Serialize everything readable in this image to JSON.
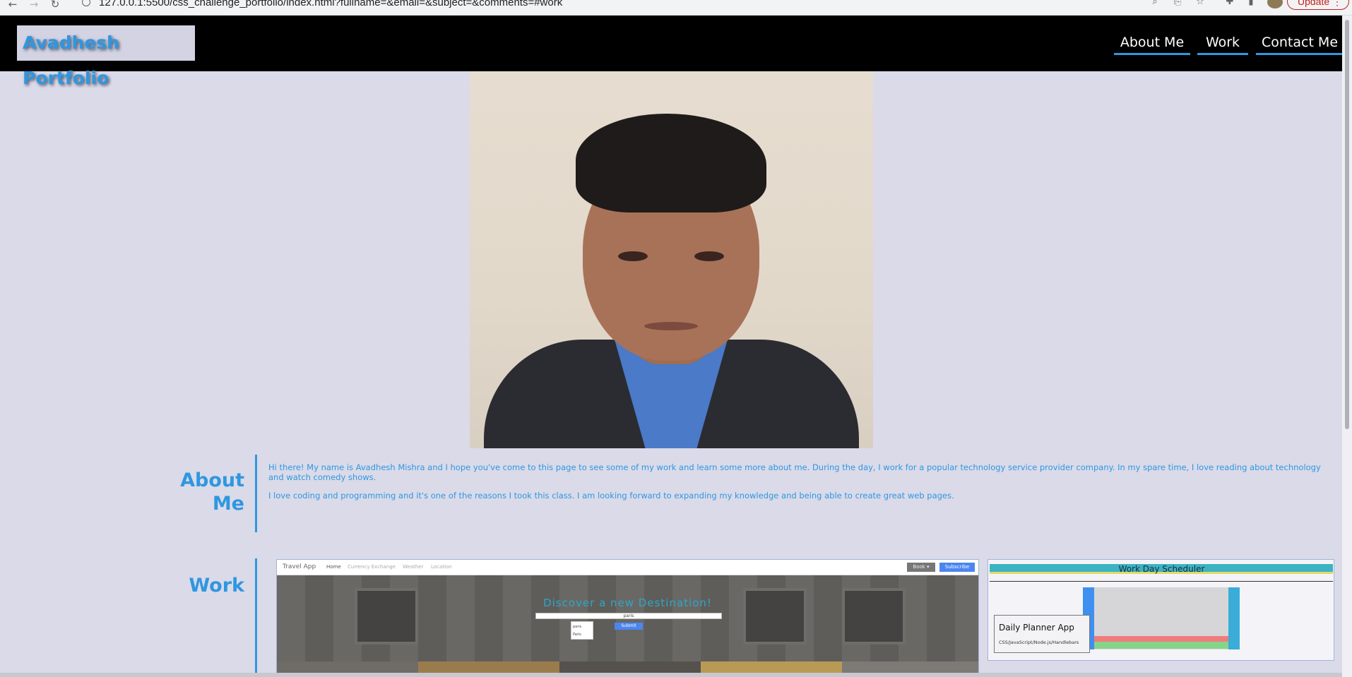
{
  "browser": {
    "url": "127.0.0.1:5500/css_challenge_portfolio/index.html?fullname=&email=&subject=&comments=#work",
    "update_label": "Update",
    "icons": [
      "back-icon",
      "forward-icon",
      "reload-icon",
      "info-icon",
      "zoom-icon",
      "share-icon",
      "star-icon",
      "extensions-icon",
      "sidebar-icon",
      "profile-avatar",
      "menu-icon"
    ]
  },
  "header": {
    "logo": "Avadhesh Portfolio",
    "nav": [
      {
        "label": "About Me"
      },
      {
        "label": "Work"
      },
      {
        "label": "Contact Me"
      }
    ],
    "accent_color": "#2f97e0"
  },
  "hero": {
    "alt": "Portrait photo"
  },
  "about": {
    "title": "About Me",
    "paragraph1": "Hi there! My name is Avadhesh Mishra and I hope you've come to this page to see some of my work and learn some more about me. During the day, I work for a popular technology service provider company. In my spare time, I love reading about technology and watch comedy shows.",
    "paragraph2": "I love coding and programming and it's one of the reasons I took this class. I am looking forward to expanding my knowledge and being able to create great web pages."
  },
  "work": {
    "title": "Work",
    "travel_app": {
      "brand": "Travel App",
      "nav": [
        "Home",
        "Currency Exchange",
        "Weather",
        "Location"
      ],
      "book": "Book ▾",
      "subscribe": "Subscribe",
      "heading": "Discover a new Destination!",
      "input_value": "paris",
      "dropdown": [
        "paris",
        "Paris"
      ],
      "submit": "Submit"
    },
    "planner_app": {
      "screenshot_title": "Work Day Scheduler",
      "label": "Daily Planner App",
      "tech": "CSS/JavaScript/Node.js/Handlebars"
    }
  }
}
